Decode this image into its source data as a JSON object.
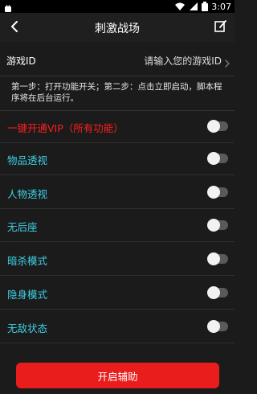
{
  "status_bar": {
    "time": "3:07",
    "icons": [
      "android-icon",
      "wifi-icon",
      "signal-icon",
      "battery-icon"
    ]
  },
  "header": {
    "title": "刺激战场",
    "back_icon": "back-arrow-icon",
    "edit_icon": "edit-icon"
  },
  "game_id": {
    "label": "游戏ID",
    "placeholder": "请输入您的游戏ID",
    "chevron_icon": "chevron-right-icon"
  },
  "instructions": "第一步：打开功能开关；第二步：点击立即启动，脚本程序将在后台运行。",
  "features": [
    {
      "label": "一键开通VIP（所有功能）",
      "color": "#ff1f1f"
    },
    {
      "label": "物品透视",
      "color": "#3fd0e6"
    },
    {
      "label": "人物透视",
      "color": "#3fd0e6"
    },
    {
      "label": "无后座",
      "color": "#3fd0e6"
    },
    {
      "label": "暗杀模式",
      "color": "#3fd0e6"
    },
    {
      "label": "隐身模式",
      "color": "#3fd0e6"
    },
    {
      "label": "无敌状态",
      "color": "#3fd0e6"
    }
  ],
  "start_button": {
    "label": "开启辅助",
    "color": "#ea1d1d"
  }
}
